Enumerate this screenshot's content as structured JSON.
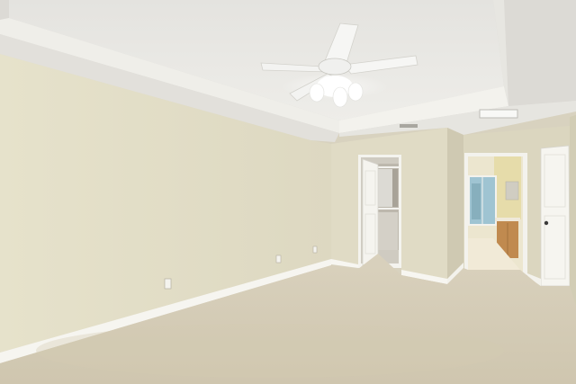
{
  "photo": {
    "colors": {
      "ceiling": "#e9e8e4",
      "ceiling_shadow": "#d6d4ce",
      "tray_face": "#f2f1ec",
      "wall_left": "#e3dfc8",
      "wall_center": "#ded9c3",
      "wall_right": "#d9d4bd",
      "baseboard": "#f7f6f1",
      "carpet": "#d7cfba",
      "carpet_dark": "#c9c0a8",
      "door": "#f4f3ee",
      "closet_interior": "#bdb8ad",
      "cabinet": "#c08a4f",
      "window": "#8fb8c8",
      "fan_blade": "#f6f6f4",
      "fan_light": "#ffffff"
    },
    "elements": [
      "ceiling-fan-icon",
      "tray-ceiling",
      "closet-door",
      "bathroom-door",
      "bathroom-window",
      "vanity-cabinet",
      "wall-outlet-icon",
      "air-vent-icon"
    ]
  }
}
